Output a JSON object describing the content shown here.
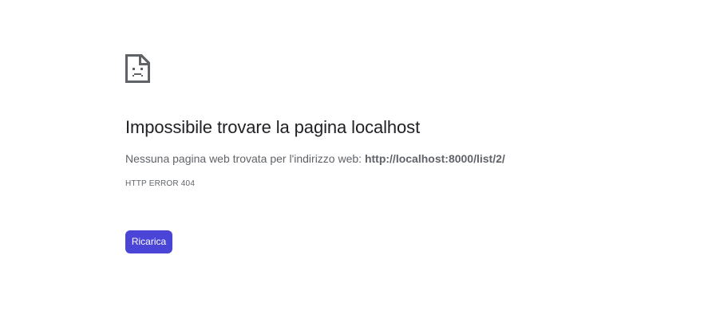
{
  "icon": {
    "name": "sad-page-icon"
  },
  "error": {
    "title": "Impossibile trovare la pagina localhost",
    "description_prefix": "Nessuna pagina web trovata per l'indirizzo web: ",
    "url": "http://localhost:8000/list/2/",
    "code": "HTTP ERROR 404"
  },
  "actions": {
    "reload_label": "Ricarica"
  },
  "colors": {
    "accent": "#4a45d6",
    "title": "#202124",
    "text": "#5f6368",
    "icon": "#5f6368"
  }
}
